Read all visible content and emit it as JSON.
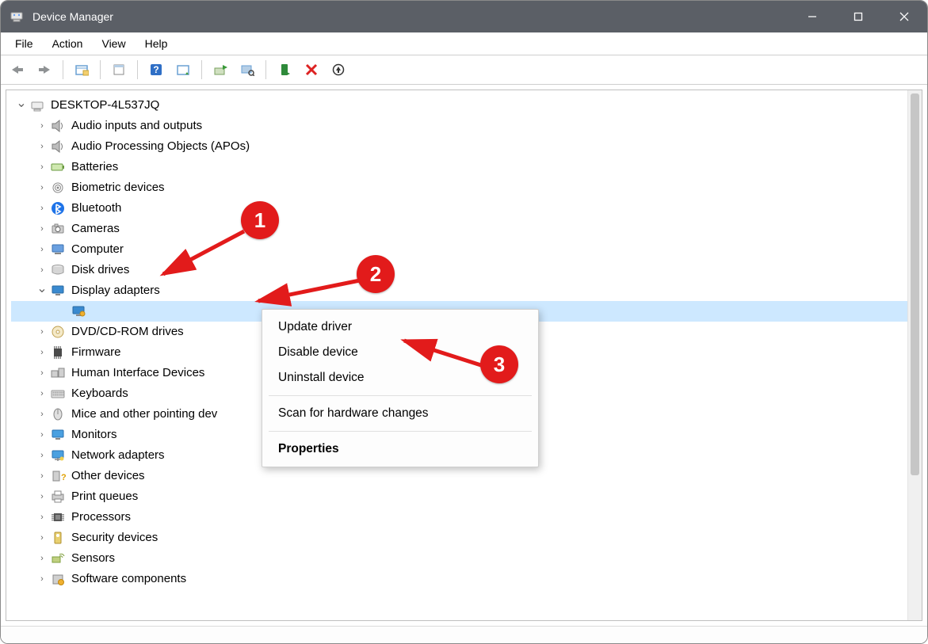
{
  "window": {
    "title": "Device Manager"
  },
  "menu": {
    "file": "File",
    "action": "Action",
    "view": "View",
    "help": "Help"
  },
  "toolbar_icons": {
    "back": "back-arrow",
    "forward": "forward-arrow",
    "show_hidden": "show-hidden",
    "properties": "properties",
    "help": "help",
    "action_center": "action-center",
    "update": "update-driver",
    "scan": "scan-hardware",
    "enable": "enable-device",
    "disable": "disable-device",
    "uninstall": "uninstall-device"
  },
  "tree": {
    "root": "DESKTOP-4L537JQ",
    "nodes": [
      {
        "label": "Audio inputs and outputs",
        "icon": "speaker",
        "chev": "›"
      },
      {
        "label": "Audio Processing Objects (APOs)",
        "icon": "speaker",
        "chev": "›"
      },
      {
        "label": "Batteries",
        "icon": "battery",
        "chev": "›"
      },
      {
        "label": "Biometric devices",
        "icon": "fingerprint",
        "chev": "›"
      },
      {
        "label": "Bluetooth",
        "icon": "bluetooth",
        "chev": "›"
      },
      {
        "label": "Cameras",
        "icon": "camera",
        "chev": "›"
      },
      {
        "label": "Computer",
        "icon": "computer",
        "chev": "›"
      },
      {
        "label": "Disk drives",
        "icon": "disk",
        "chev": "›"
      },
      {
        "label": "Display adapters",
        "icon": "display",
        "chev": "⌄",
        "children": [
          {
            "label": "",
            "icon": "gpu",
            "selected": true
          }
        ]
      },
      {
        "label": "DVD/CD-ROM drives",
        "icon": "dvd",
        "chev": "›"
      },
      {
        "label": "Firmware",
        "icon": "firmware",
        "chev": "›"
      },
      {
        "label": "Human Interface Devices",
        "icon": "hid",
        "chev": "›"
      },
      {
        "label": "Keyboards",
        "icon": "keyboard",
        "chev": "›"
      },
      {
        "label": "Mice and other pointing dev",
        "icon": "mouse",
        "chev": "›"
      },
      {
        "label": "Monitors",
        "icon": "monitor",
        "chev": "›"
      },
      {
        "label": "Network adapters",
        "icon": "network",
        "chev": "›"
      },
      {
        "label": "Other devices",
        "icon": "other",
        "chev": "›"
      },
      {
        "label": "Print queues",
        "icon": "printer",
        "chev": "›"
      },
      {
        "label": "Processors",
        "icon": "cpu",
        "chev": "›"
      },
      {
        "label": "Security devices",
        "icon": "security",
        "chev": "›"
      },
      {
        "label": "Sensors",
        "icon": "sensor",
        "chev": "›"
      },
      {
        "label": "Software components",
        "icon": "software",
        "chev": "›"
      }
    ]
  },
  "context_menu": {
    "update": "Update driver",
    "disable": "Disable device",
    "uninstall": "Uninstall device",
    "scan": "Scan for hardware changes",
    "properties": "Properties"
  },
  "annotations": {
    "b1": "1",
    "b2": "2",
    "b3": "3"
  }
}
